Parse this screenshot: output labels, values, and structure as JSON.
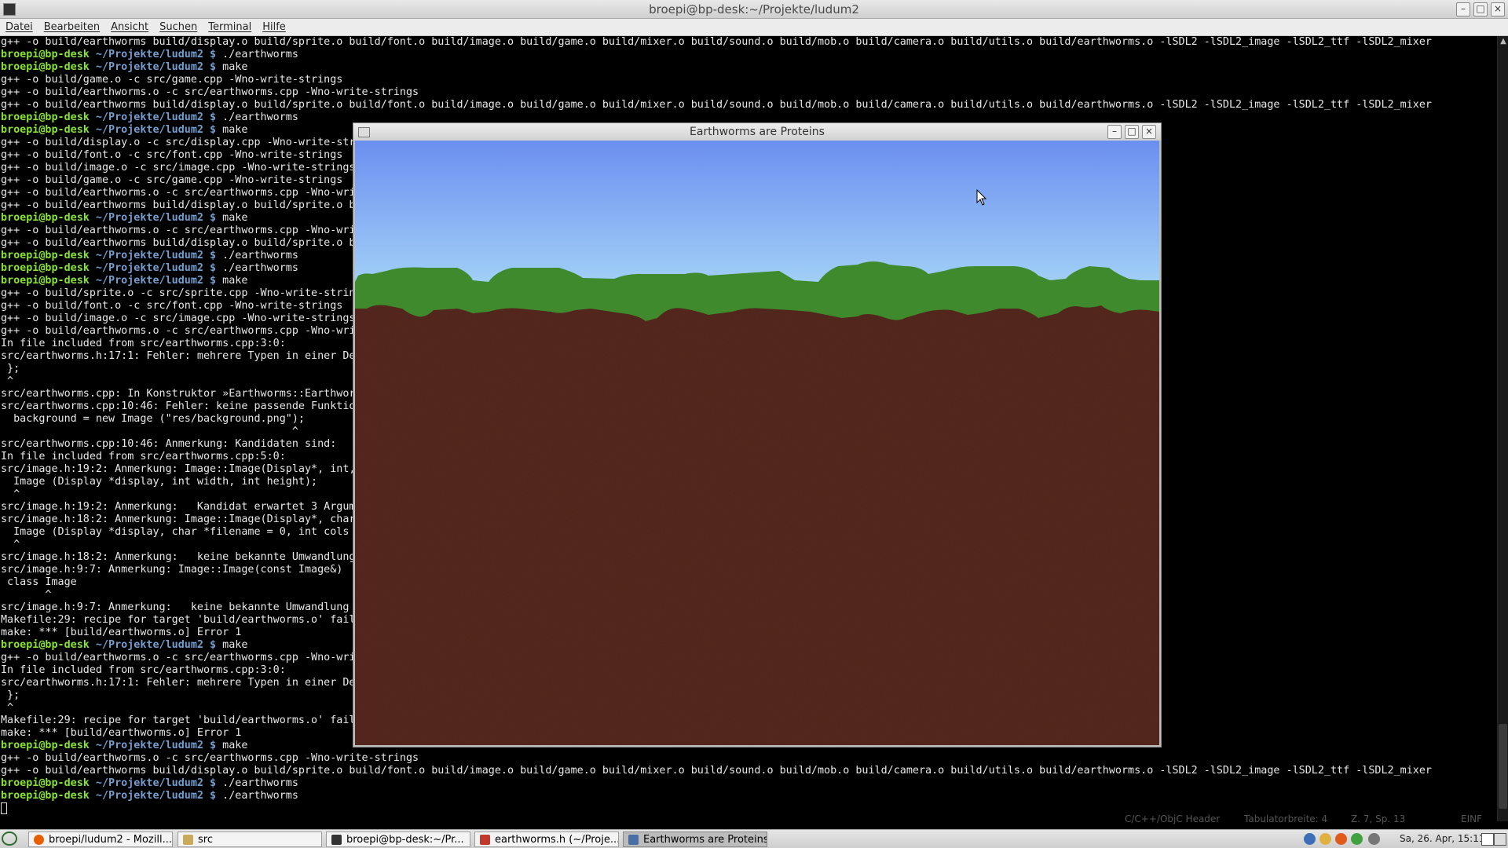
{
  "window": {
    "title": "broepi@bp-desk:~/Projekte/ludum2"
  },
  "menu": [
    "Datei",
    "Bearbeiten",
    "Ansicht",
    "Suchen",
    "Terminal",
    "Hilfe"
  ],
  "terminal": {
    "lines": [
      "g++ -o build/earthworms build/display.o build/sprite.o build/font.o build/image.o build/game.o build/mixer.o build/sound.o build/mob.o build/camera.o build/utils.o build/earthworms.o -lSDL2 -lSDL2_image -lSDL2_ttf -lSDL2_mixer",
      {
        "user": "broepi@bp-desk",
        "dir": " ~/Projekte/ludum2 $",
        "cmd": " ./earthworms"
      },
      {
        "user": "broepi@bp-desk",
        "dir": " ~/Projekte/ludum2 $",
        "cmd": " make"
      },
      "g++ -o build/game.o -c src/game.cpp -Wno-write-strings",
      "g++ -o build/earthworms.o -c src/earthworms.cpp -Wno-write-strings",
      "g++ -o build/earthworms build/display.o build/sprite.o build/font.o build/image.o build/game.o build/mixer.o build/sound.o build/mob.o build/camera.o build/utils.o build/earthworms.o -lSDL2 -lSDL2_image -lSDL2_ttf -lSDL2_mixer",
      {
        "user": "broepi@bp-desk",
        "dir": " ~/Projekte/ludum2 $",
        "cmd": " ./earthworms"
      },
      {
        "user": "broepi@bp-desk",
        "dir": " ~/Projekte/ludum2 $",
        "cmd": " make"
      },
      "g++ -o build/display.o -c src/display.cpp -Wno-write-str",
      "g++ -o build/font.o -c src/font.cpp -Wno-write-strings",
      "g++ -o build/image.o -c src/image.cpp -Wno-write-strings",
      "g++ -o build/game.o -c src/game.cpp -Wno-write-strings",
      "g++ -o build/earthworms.o -c src/earthworms.cpp -Wno-wri",
      "g++ -o build/earthworms build/display.o build/sprite.o b                                                                              SDL2 -lSDL2_image -lSDL2_ttf -lSDL2_mixer",
      {
        "user": "broepi@bp-desk",
        "dir": " ~/Projekte/ludum2 $",
        "cmd": " make"
      },
      "g++ -o build/earthworms.o -c src/earthworms.cpp -Wno-wri",
      "g++ -o build/earthworms build/display.o build/sprite.o b                                                                              SDL2 -lSDL2_image -lSDL2_ttf -lSDL2_mixer",
      {
        "user": "broepi@bp-desk",
        "dir": " ~/Projekte/ludum2 $",
        "cmd": " ./earthworms"
      },
      {
        "user": "broepi@bp-desk",
        "dir": " ~/Projekte/ludum2 $",
        "cmd": " ./earthworms"
      },
      {
        "user": "broepi@bp-desk",
        "dir": " ~/Projekte/ludum2 $",
        "cmd": " make"
      },
      "g++ -o build/sprite.o -c src/sprite.cpp -Wno-write-strin",
      "g++ -o build/font.o -c src/font.cpp -Wno-write-strings",
      "g++ -o build/image.o -c src/image.cpp -Wno-write-strings",
      "g++ -o build/earthworms.o -c src/earthworms.cpp -Wno-wri",
      "In file included from src/earthworms.cpp:3:0:",
      "src/earthworms.h:17:1: Fehler: mehrere Typen in einer De",
      " };",
      " ^",
      "src/earthworms.cpp: In Konstruktor »Earthworms::Earthwor",
      "src/earthworms.cpp:10:46: Fehler: keine passende Funktio",
      "  background = new Image (\"res/background.png\");",
      "                                              ^",
      "src/earthworms.cpp:10:46: Anmerkung: Kandidaten sind:",
      "In file included from src/earthworms.cpp:5:0:",
      "src/image.h:19:2: Anmerkung: Image::Image(Display*, int,",
      "  Image (Display *display, int width, int height);",
      "  ^",
      "src/image.h:19:2: Anmerkung:   Kandidat erwartet 3 Argum",
      "src/image.h:18:2: Anmerkung: Image::Image(Display*, char",
      "  Image (Display *display, char *filename = 0, int cols",
      "  ^",
      "src/image.h:18:2: Anmerkung:   keine bekannte Umwandlung",
      "src/image.h:9:7: Anmerkung: Image::Image(const Image&)",
      " class Image",
      "       ^",
      "src/image.h:9:7: Anmerkung:   keine bekannte Umwandlung",
      "Makefile:29: recipe for target 'build/earthworms.o' fail",
      "make: *** [build/earthworms.o] Error 1",
      {
        "user": "broepi@bp-desk",
        "dir": " ~/Projekte/ludum2 $",
        "cmd": " make"
      },
      "g++ -o build/earthworms.o -c src/earthworms.cpp -Wno-wri",
      "In file included from src/earthworms.cpp:3:0:",
      "src/earthworms.h:17:1: Fehler: mehrere Typen in einer De",
      " };",
      " ^",
      "Makefile:29: recipe for target 'build/earthworms.o' fail",
      "make: *** [build/earthworms.o] Error 1",
      {
        "user": "broepi@bp-desk",
        "dir": " ~/Projekte/ludum2 $",
        "cmd": " make"
      },
      "g++ -o build/earthworms.o -c src/earthworms.cpp -Wno-write-strings",
      "g++ -o build/earthworms build/display.o build/sprite.o build/font.o build/image.o build/game.o build/mixer.o build/sound.o build/mob.o build/camera.o build/utils.o build/earthworms.o -lSDL2 -lSDL2_image -lSDL2_ttf -lSDL2_mixer",
      {
        "user": "broepi@bp-desk",
        "dir": " ~/Projekte/ludum2 $",
        "cmd": " ./earthworms"
      },
      {
        "user": "broepi@bp-desk",
        "dir": " ~/Projekte/ludum2 $",
        "cmd": " ./earthworms"
      }
    ]
  },
  "status_bar": {
    "language": "C/C++/ObjC Header",
    "tab_width": "Tabulatorbreite: 4",
    "position": "Z. 7, Sp. 13",
    "mode": "EINF"
  },
  "game_window": {
    "title": "Earthworms are Proteins"
  },
  "taskbar": {
    "tasks": [
      {
        "label": "broepi/ludum2 - Mozill...",
        "icon": "firefox-icon",
        "color": "#e66000"
      },
      {
        "label": "src",
        "icon": "folder-icon",
        "color": "#c9a95a"
      },
      {
        "label": "broepi@bp-desk:~/Pr...",
        "icon": "terminal-icon",
        "color": "#333333"
      },
      {
        "label": "earthworms.h (~/Proje...",
        "icon": "text-editor-icon",
        "color": "#c0392b"
      },
      {
        "label": "Earthworms are Proteins",
        "icon": "window-icon",
        "color": "#4a6fa5"
      }
    ],
    "clock": "Sa, 26. Apr, 15:11"
  },
  "colors": {
    "prompt_user": "#8ae234",
    "prompt_dir": "#729fcf",
    "sky_top": "#6b8ff0",
    "sky_bottom": "#a6d6f7",
    "grass": "#3f8a2c",
    "dirt": "#5a2a1f"
  }
}
